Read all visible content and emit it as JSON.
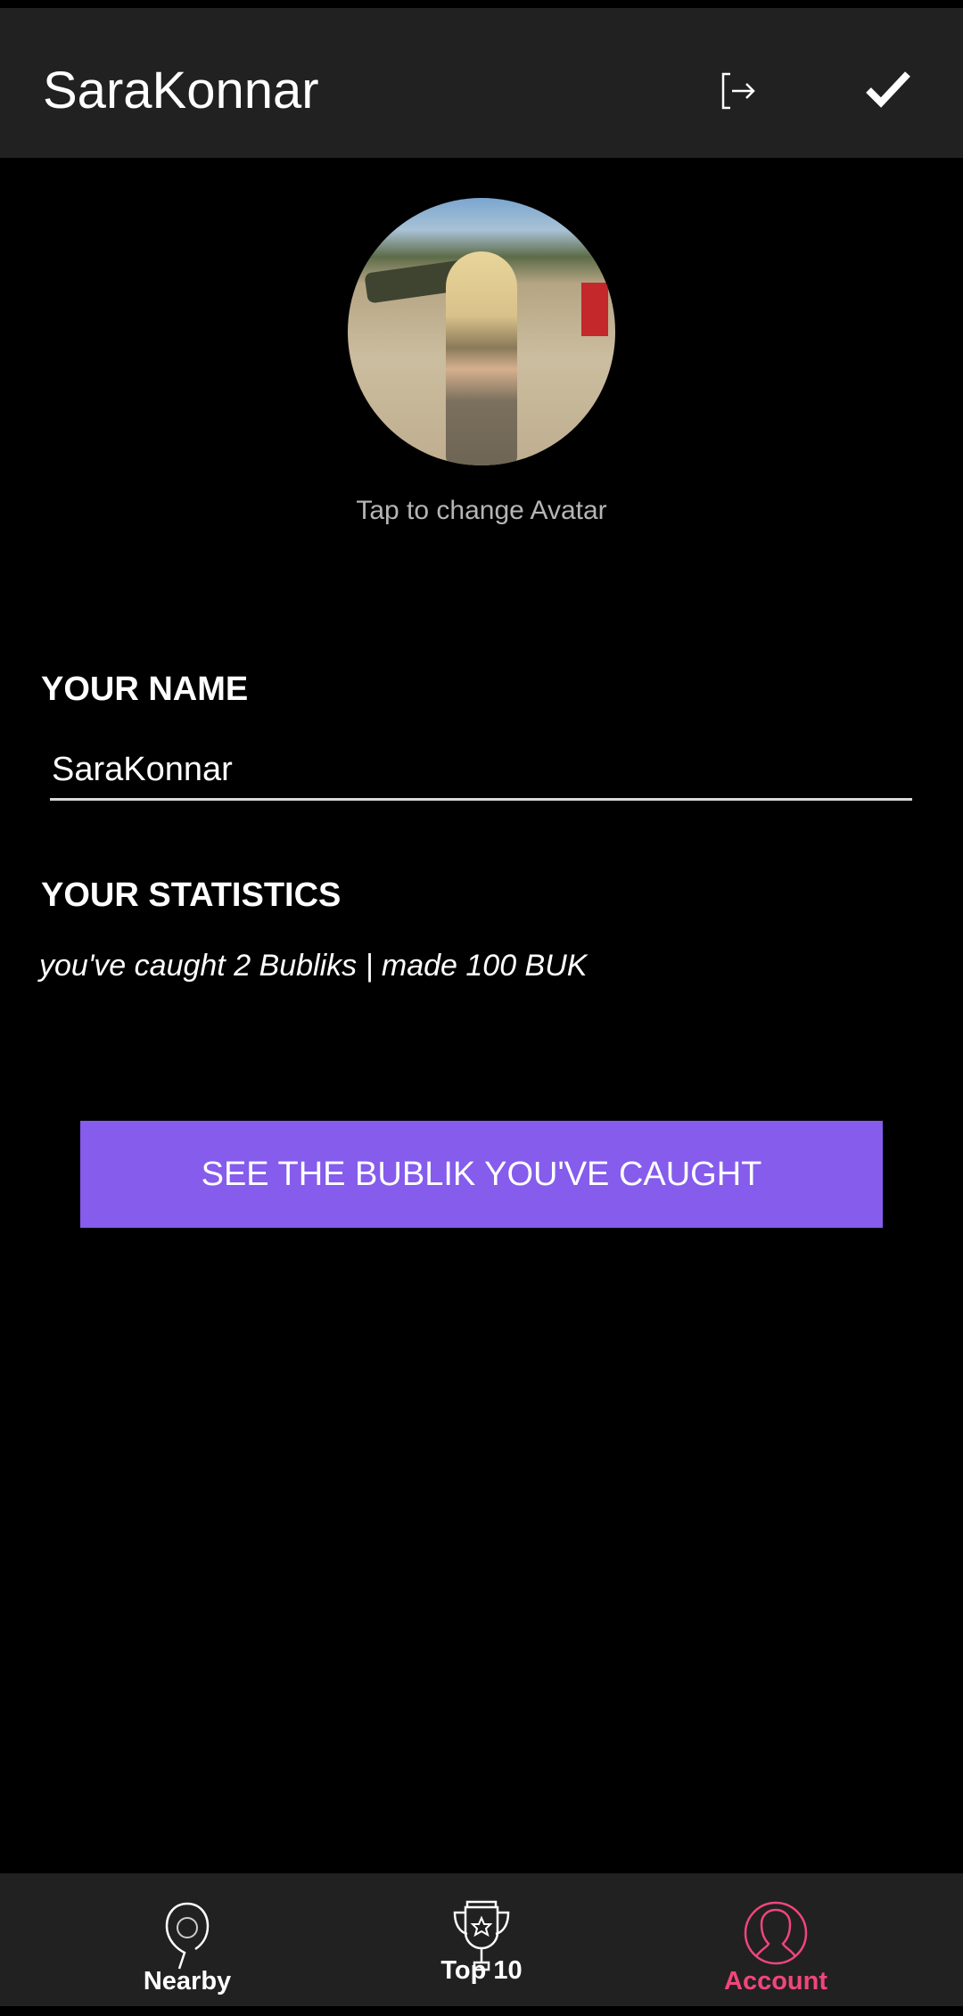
{
  "header": {
    "title": "SaraKonnar",
    "logout_icon": "logout-icon",
    "confirm_icon": "check-icon"
  },
  "avatar": {
    "hint": "Tap to change Avatar"
  },
  "name_section": {
    "label": "YOUR NAME",
    "value": "SaraKonnar"
  },
  "stats_section": {
    "label": "YOUR STATISTICS",
    "text": "you've caught 2 Bubliks | made 100 BUK"
  },
  "action_button": {
    "label": "SEE THE BUBLIK YOU'VE CAUGHT"
  },
  "bottom_nav": {
    "items": [
      {
        "label": "Nearby",
        "icon": "map-pin-icon"
      },
      {
        "label": "Top 10",
        "icon": "trophy-icon"
      },
      {
        "label": "Account",
        "icon": "user-icon",
        "active": true
      }
    ]
  },
  "colors": {
    "accent": "#855cec",
    "active_tab": "#f0467c",
    "bar": "#212121"
  }
}
